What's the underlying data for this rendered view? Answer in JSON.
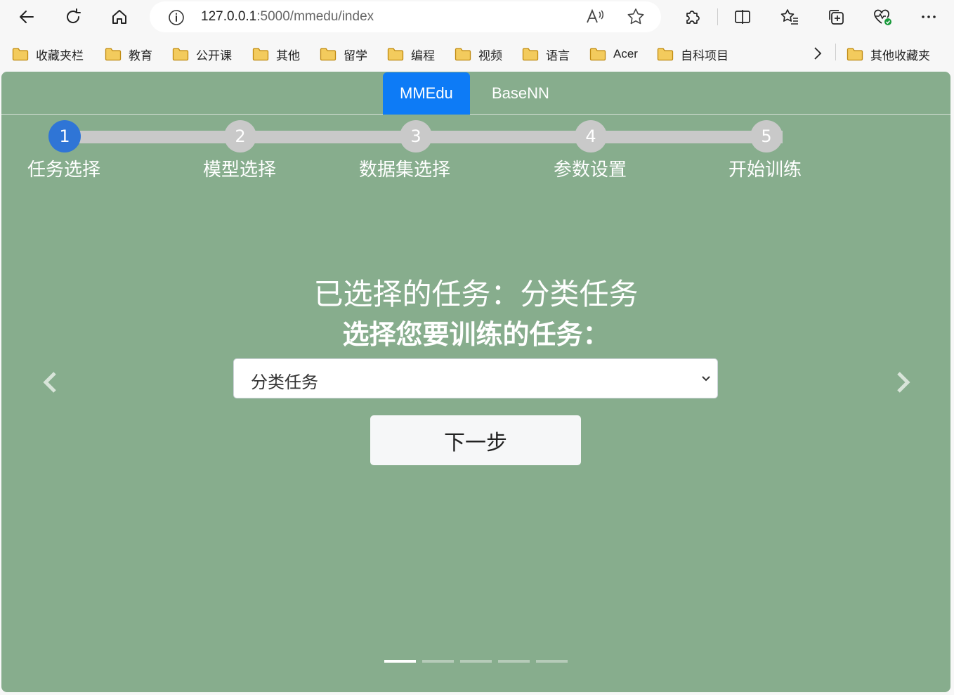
{
  "browser": {
    "url_host": "127.0.0.1",
    "url_rest": ":5000/mmedu/index"
  },
  "bookmarks": [
    {
      "label": "收藏夹栏"
    },
    {
      "label": "教育"
    },
    {
      "label": "公开课"
    },
    {
      "label": "其他"
    },
    {
      "label": "留学"
    },
    {
      "label": "编程"
    },
    {
      "label": "视频"
    },
    {
      "label": "语言"
    },
    {
      "label": "Acer"
    },
    {
      "label": "自科项目"
    }
  ],
  "other_bookmarks": "其他收藏夹",
  "tabs": [
    {
      "label": "MMEdu",
      "active": true
    },
    {
      "label": "BaseNN",
      "active": false
    }
  ],
  "steps": [
    {
      "number": "1",
      "label": "任务选择",
      "active": true
    },
    {
      "number": "2",
      "label": "模型选择",
      "active": false
    },
    {
      "number": "3",
      "label": "数据集选择",
      "active": false
    },
    {
      "number": "4",
      "label": "参数设置",
      "active": false
    },
    {
      "number": "5",
      "label": "开始训练",
      "active": false
    }
  ],
  "main": {
    "selected_text": "已选择的任务：分类任务",
    "choose_text": "选择您要训练的任务：",
    "select_value": "分类任务",
    "next_label": "下一步"
  },
  "carousel": {
    "slide_count": 5,
    "active_index": 0
  },
  "colors": {
    "page_bg": "#87ad8d",
    "tab_active": "#0d7bf6",
    "step_active": "#2f75d6",
    "step_inactive": "#c9c9c9"
  }
}
